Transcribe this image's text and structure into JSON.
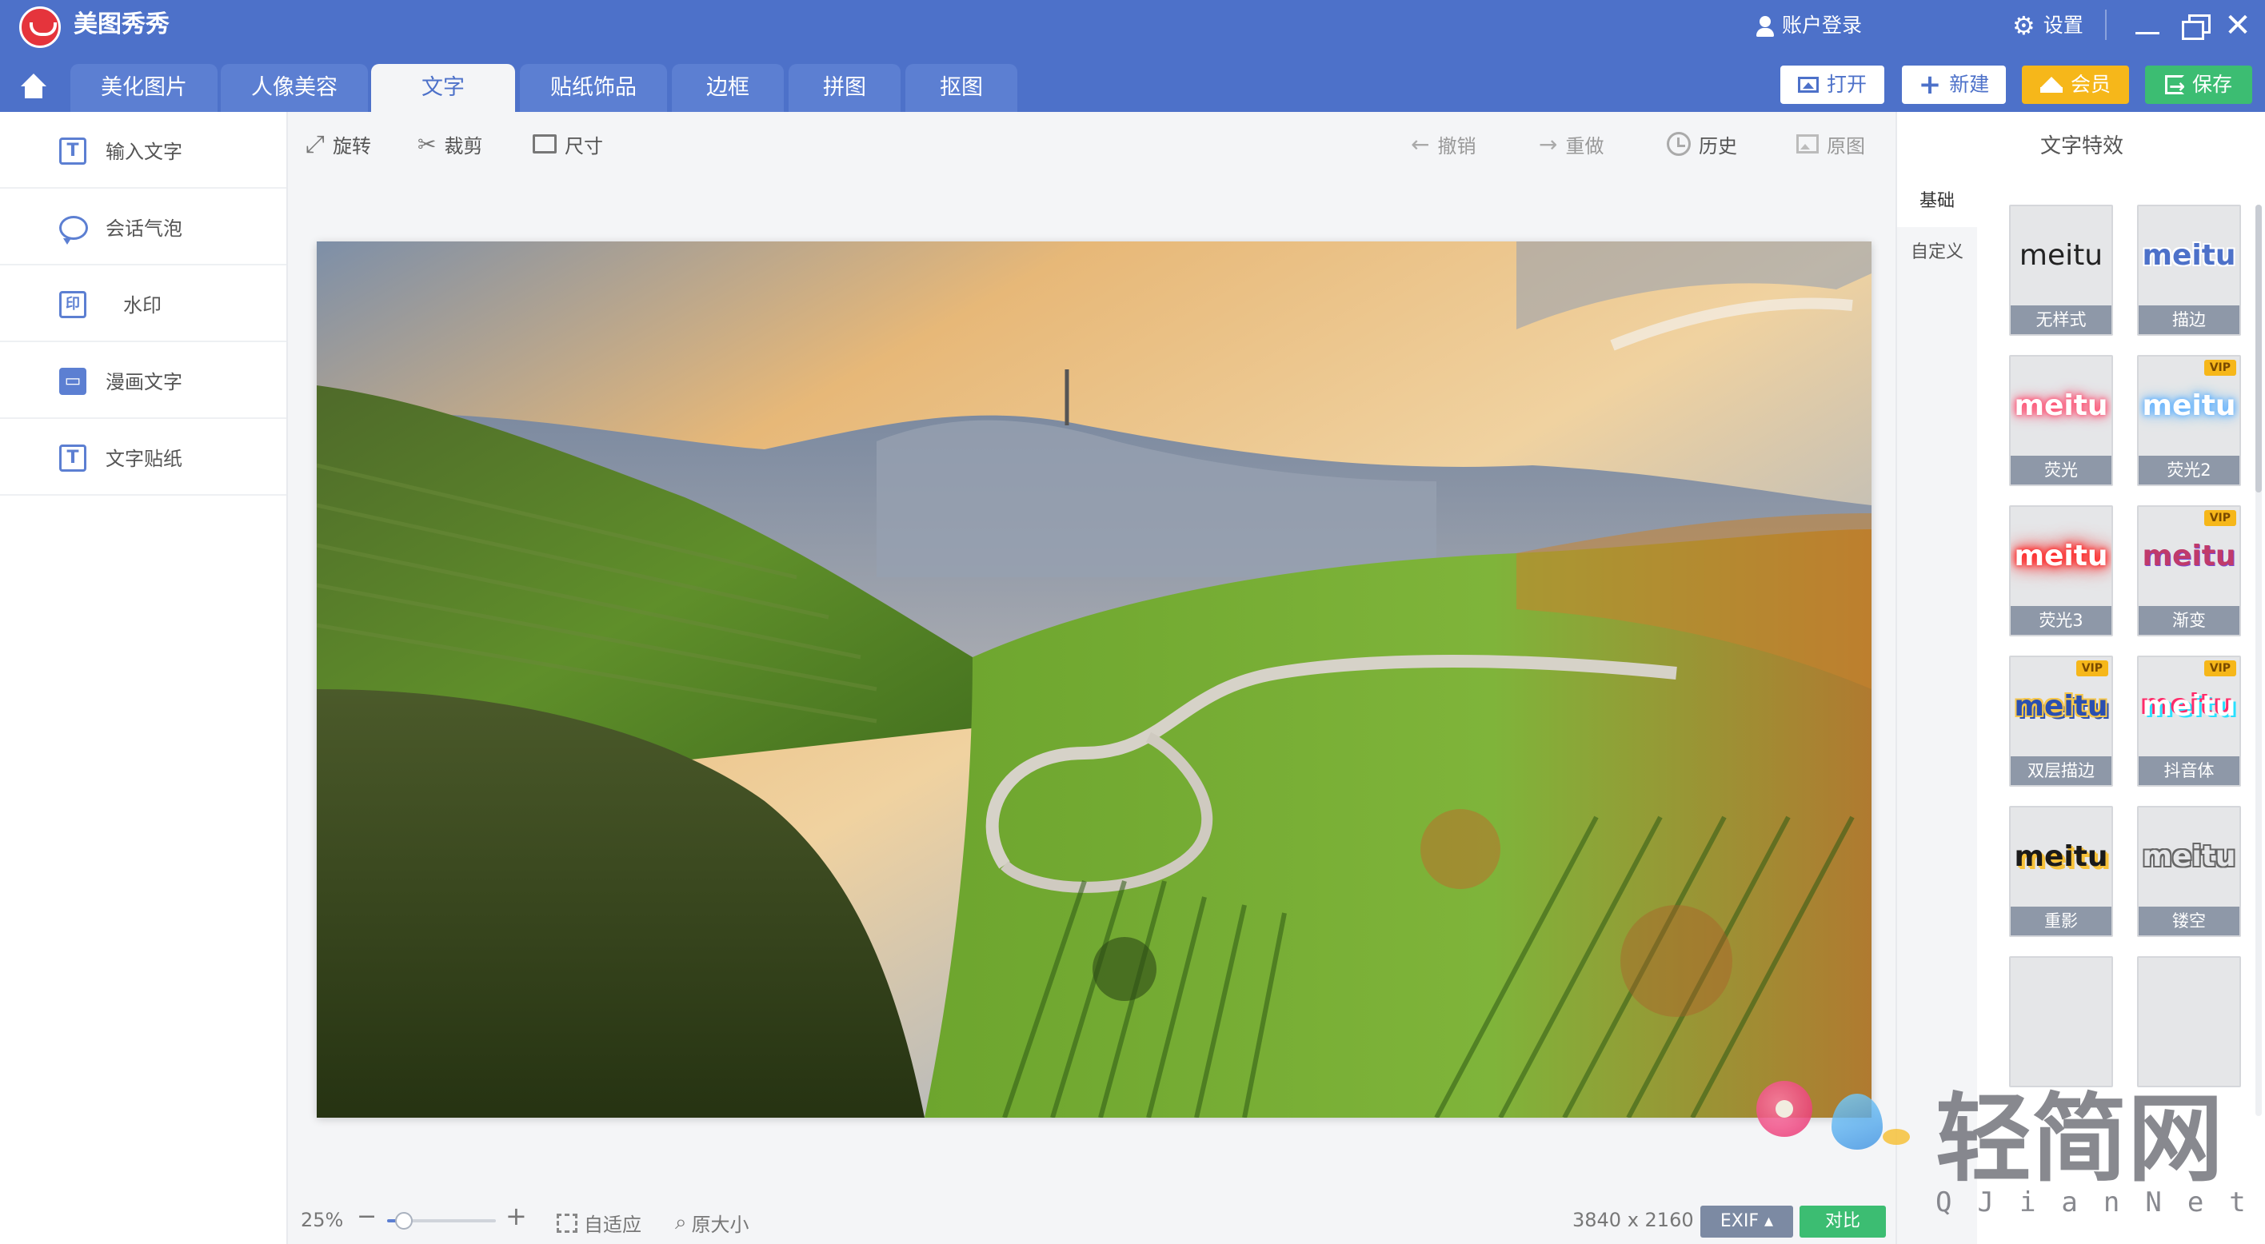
{
  "app": {
    "title": "美图秀秀"
  },
  "topbar": {
    "account_label": "账户登录",
    "settings_label": "设置",
    "window_controls": {
      "minimize": "minimize-icon",
      "maximize": "restore-icon",
      "close": "✕"
    }
  },
  "tabs": [
    {
      "label": "美化图片"
    },
    {
      "label": "人像美容"
    },
    {
      "label": "文字",
      "active": true
    },
    {
      "label": "贴纸饰品"
    },
    {
      "label": "边框"
    },
    {
      "label": "拼图"
    },
    {
      "label": "抠图"
    }
  ],
  "toolbar_buttons": {
    "open": "打开",
    "new": "新建",
    "vip": "会员",
    "save": "保存"
  },
  "left_menu": [
    {
      "icon": "text-input-icon",
      "glyph": "T",
      "label": "输入文字"
    },
    {
      "icon": "speech-bubble-icon",
      "glyph": "",
      "label": "会话气泡"
    },
    {
      "icon": "watermark-icon",
      "glyph": "印",
      "label": "水印"
    },
    {
      "icon": "comic-text-icon",
      "glyph": "▭",
      "label": "漫画文字"
    },
    {
      "icon": "text-sticker-icon",
      "glyph": "T",
      "label": "文字贴纸"
    }
  ],
  "edit_tools": {
    "rotate": "旋转",
    "crop": "裁剪",
    "size": "尺寸",
    "undo": "撤销",
    "redo": "重做",
    "history": "历史",
    "original": "原图"
  },
  "status": {
    "zoom": "25%",
    "zoom_level": 0.25,
    "fit": "自适应",
    "actual_size": "原大小",
    "dimensions": "3840 x 2160",
    "exif": "EXIF",
    "compare": "对比"
  },
  "right_panel": {
    "title": "文字特效",
    "tabs": [
      "基础",
      "自定义"
    ],
    "styles": [
      {
        "sample": "meitu",
        "label": "无样式",
        "vip": false
      },
      {
        "sample": "meitu",
        "label": "描边",
        "vip": false
      },
      {
        "sample": "meitu",
        "label": "荧光",
        "vip": false
      },
      {
        "sample": "meitu",
        "label": "荧光2",
        "vip": true
      },
      {
        "sample": "meitu",
        "label": "荧光3",
        "vip": false
      },
      {
        "sample": "meitu",
        "label": "渐变",
        "vip": true
      },
      {
        "sample": "meitu",
        "label": "双层描边",
        "vip": true
      },
      {
        "sample": "meitu",
        "label": "抖音体",
        "vip": true
      },
      {
        "sample": "meitu",
        "label": "重影",
        "vip": false
      },
      {
        "sample": "meitu",
        "label": "镂空",
        "vip": false
      }
    ],
    "vip_badge": "VIP"
  },
  "watermark": {
    "text": "轻简网",
    "subtext": "QJianNet"
  },
  "colors": {
    "header": "#4d71c9",
    "accent_vip": "#f6b71a",
    "save_green": "#3cbd72"
  }
}
